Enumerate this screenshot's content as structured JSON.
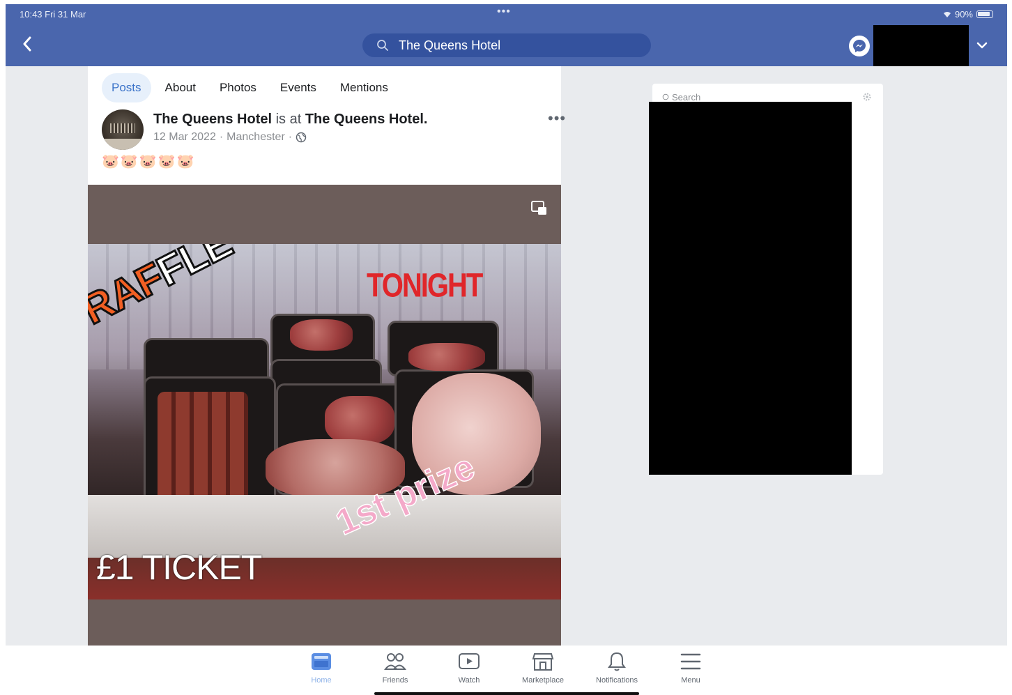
{
  "status_bar": {
    "time_date": "10:43  Fri 31 Mar",
    "multitask_dots": "•••",
    "battery_percent": "90%"
  },
  "nav": {
    "search_value": "The Queens Hotel"
  },
  "tabs": [
    {
      "label": "Posts",
      "active": true
    },
    {
      "label": "About",
      "active": false
    },
    {
      "label": "Photos",
      "active": false
    },
    {
      "label": "Events",
      "active": false
    },
    {
      "label": "Mentions",
      "active": false
    }
  ],
  "post": {
    "author": "The Queens Hotel",
    "connector": "is at",
    "place": "The Queens Hotel.",
    "date": "12 Mar 2022",
    "location": "Manchester",
    "separator": "·",
    "more": "•••",
    "emoji_line": "🐷🐷🐷🐷🐷"
  },
  "photo_text": {
    "raffle_part1": "RAF",
    "raffle_part2": "FLE",
    "tonight": "TONIGHT",
    "prize": "1st prize",
    "ticket": "£1 TICKET"
  },
  "side_panel": {
    "search_placeholder": "Search"
  },
  "bottom_tabs": [
    {
      "label": "Home",
      "icon": "home-icon",
      "active": true
    },
    {
      "label": "Friends",
      "icon": "friends-icon",
      "active": false
    },
    {
      "label": "Watch",
      "icon": "watch-icon",
      "active": false
    },
    {
      "label": "Marketplace",
      "icon": "marketplace-icon",
      "active": false
    },
    {
      "label": "Notifications",
      "icon": "bell-icon",
      "active": false
    },
    {
      "label": "Menu",
      "icon": "menu-icon",
      "active": false
    }
  ],
  "colors": {
    "brand_blue": "#4a66ad",
    "search_bg": "#34529e",
    "active_tab": "#3b73c9",
    "active_tab_bg": "#e7f0fb",
    "page_bg": "#e9ebee"
  }
}
